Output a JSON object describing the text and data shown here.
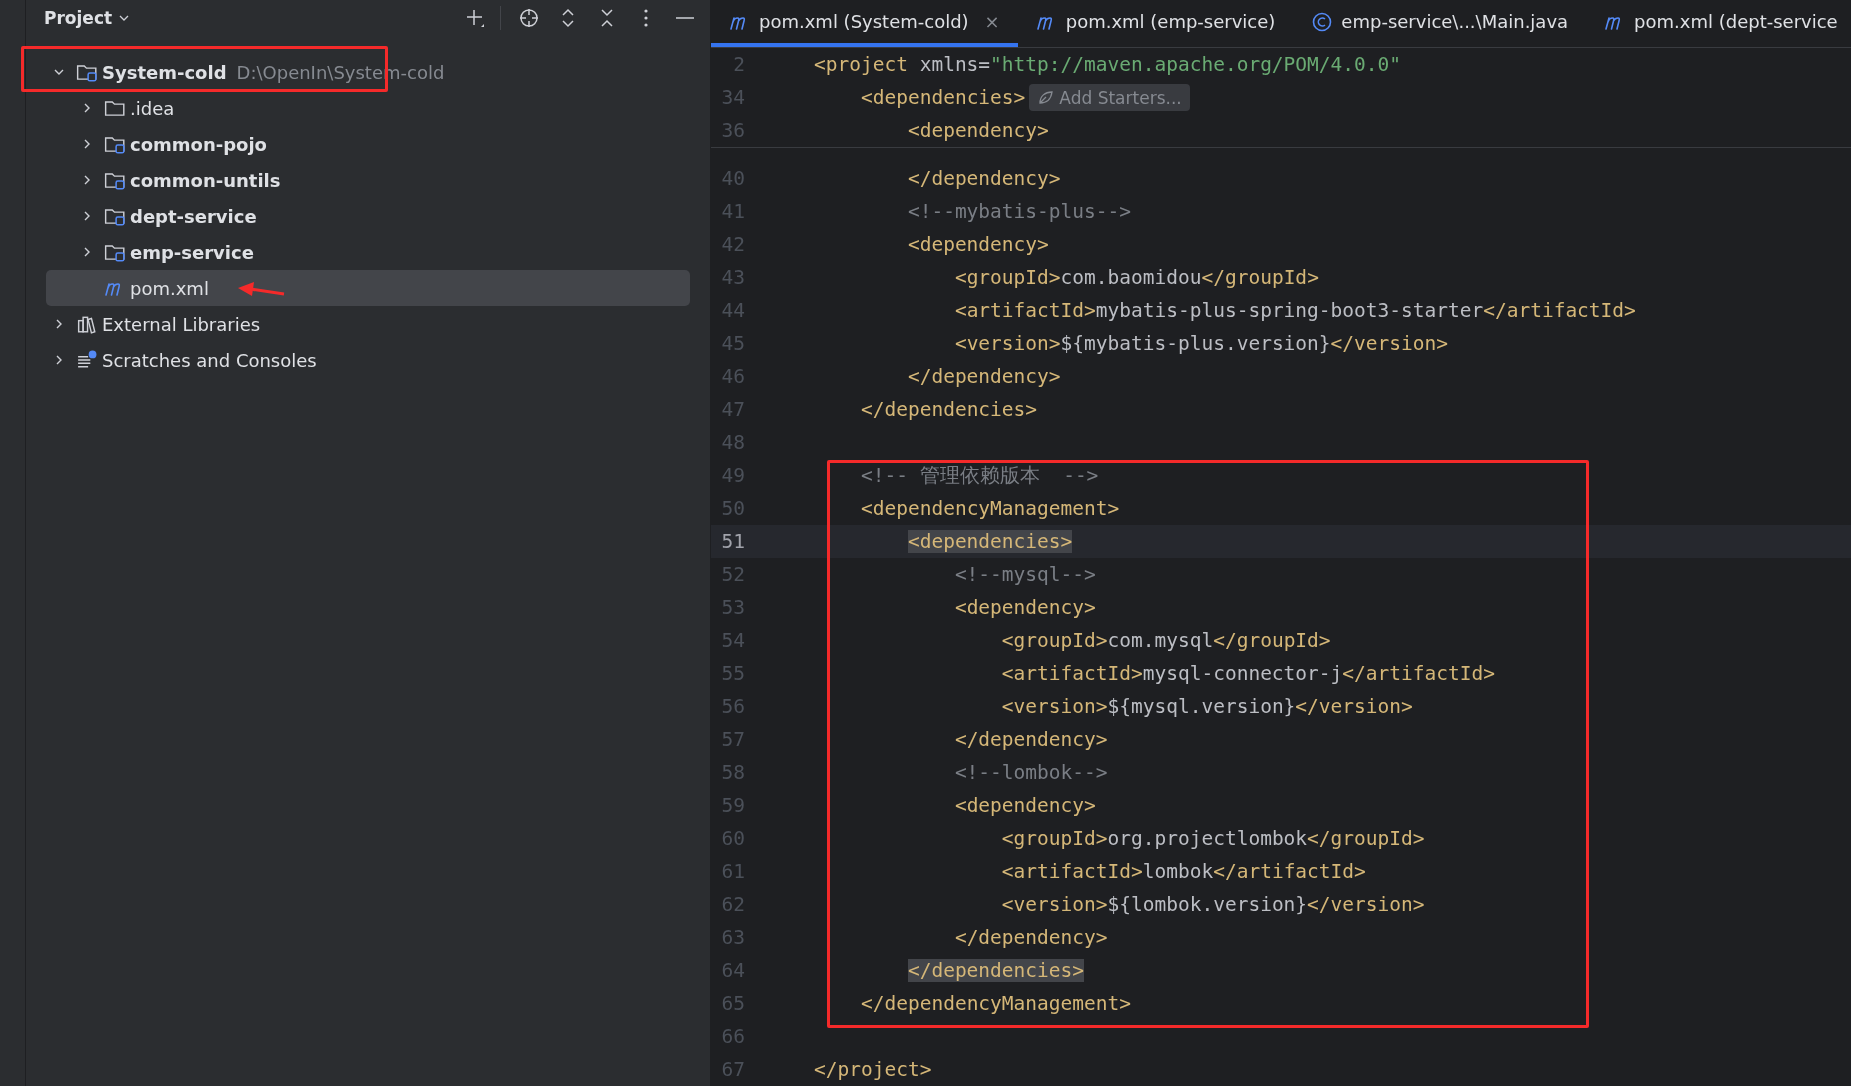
{
  "project_panel": {
    "title": "Project",
    "tree": [
      {
        "label": "System-cold",
        "hint": "D:\\OpenIn\\System-cold",
        "kind": "module",
        "expanded": true,
        "selected": false,
        "children": [
          {
            "label": ".idea",
            "kind": "folder",
            "expanded": false,
            "selected": false
          },
          {
            "label": "common-pojo",
            "kind": "module",
            "expanded": false,
            "selected": false
          },
          {
            "label": "common-untils",
            "kind": "module",
            "expanded": false,
            "selected": false
          },
          {
            "label": "dept-service",
            "kind": "module",
            "expanded": false,
            "selected": false
          },
          {
            "label": "emp-service",
            "kind": "module",
            "expanded": false,
            "selected": false
          },
          {
            "label": "pom.xml",
            "kind": "maven",
            "selected": true
          }
        ]
      },
      {
        "label": "External Libraries",
        "kind": "libraries",
        "expanded": false,
        "selected": false
      },
      {
        "label": "Scratches and Consoles",
        "kind": "scratches",
        "expanded": false,
        "selected": false
      }
    ]
  },
  "tabs": [
    {
      "label": "pom.xml (System-cold)",
      "kind": "maven",
      "selected": true,
      "close": "×"
    },
    {
      "label": "pom.xml (emp-service)",
      "kind": "maven",
      "selected": false
    },
    {
      "label": "emp-service\\...\\Main.java",
      "kind": "java",
      "selected": false
    },
    {
      "label": "pom.xml (dept-service",
      "kind": "maven",
      "selected": false
    }
  ],
  "sticky_lines": [
    {
      "no": "2",
      "text": "<project xmlns=\"http://maven.apache.org/POM/4.0.0\"",
      "kind": "code"
    },
    {
      "no": "34",
      "text": "    <dependencies>",
      "kind": "code",
      "inlay": "Add Starters..."
    },
    {
      "no": "36",
      "text": "        <dependency>",
      "kind": "code"
    }
  ],
  "lines": [
    {
      "no": "40",
      "text": "        </dependency>",
      "kind": "code"
    },
    {
      "no": "41",
      "text": "        <!--mybatis-plus-->",
      "kind": "comment"
    },
    {
      "no": "42",
      "text": "        <dependency>",
      "kind": "code"
    },
    {
      "no": "43",
      "text": "            <groupId>com.baomidou</groupId>",
      "kind": "code"
    },
    {
      "no": "44",
      "text": "            <artifactId>mybatis-plus-spring-boot3-starter</artifactId>",
      "kind": "code"
    },
    {
      "no": "45",
      "text": "            <version>${mybatis-plus.version}</version>",
      "kind": "code"
    },
    {
      "no": "46",
      "text": "        </dependency>",
      "kind": "code"
    },
    {
      "no": "47",
      "text": "    </dependencies>",
      "kind": "code"
    },
    {
      "no": "48"
    },
    {
      "no": "49",
      "text": "    <!-- 管理依赖版本  -->",
      "kind": "comment"
    },
    {
      "no": "50",
      "text": "    <dependencyManagement>",
      "kind": "code"
    },
    {
      "no": "51",
      "text": "        <dependencies>",
      "kind": "code",
      "current": true,
      "match": true
    },
    {
      "no": "52",
      "text": "            <!--mysql-->",
      "kind": "comment"
    },
    {
      "no": "53",
      "text": "            <dependency>",
      "kind": "code"
    },
    {
      "no": "54",
      "text": "                <groupId>com.mysql</groupId>",
      "kind": "code"
    },
    {
      "no": "55",
      "text": "                <artifactId>mysql-connector-j</artifactId>",
      "kind": "code"
    },
    {
      "no": "56",
      "text": "                <version>${mysql.version}</version>",
      "kind": "code"
    },
    {
      "no": "57",
      "text": "            </dependency>",
      "kind": "code"
    },
    {
      "no": "58",
      "text": "            <!--lombok-->",
      "kind": "comment"
    },
    {
      "no": "59",
      "text": "            <dependency>",
      "kind": "code"
    },
    {
      "no": "60",
      "text": "                <groupId>org.projectlombok</groupId>",
      "kind": "code"
    },
    {
      "no": "61",
      "text": "                <artifactId>lombok</artifactId>",
      "kind": "code"
    },
    {
      "no": "62",
      "text": "                <version>${lombok.version}</version>",
      "kind": "code"
    },
    {
      "no": "63",
      "text": "            </dependency>",
      "kind": "code"
    },
    {
      "no": "64",
      "text": "        </dependencies>",
      "kind": "code",
      "match": true
    },
    {
      "no": "65",
      "text": "    </dependencyManagement>",
      "kind": "code"
    },
    {
      "no": "66"
    },
    {
      "no": "67",
      "text": "</project>",
      "kind": "code"
    }
  ]
}
